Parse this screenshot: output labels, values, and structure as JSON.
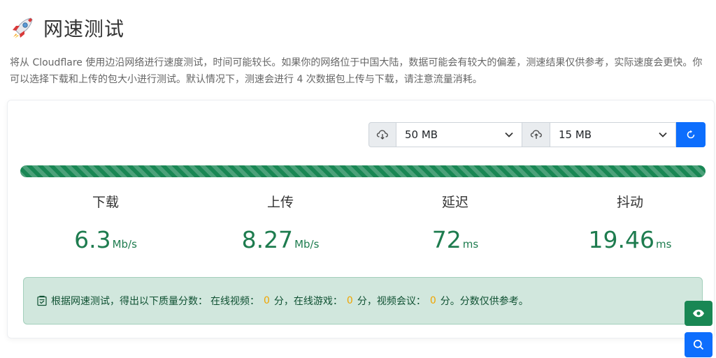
{
  "header": {
    "title": "网速测试",
    "description": "将从 Cloudflare 使用边沿网络进行速度测试，时间可能较长。如果你的网络位于中国大陆，数据可能会有较大的偏差，测速结果仅供参考，实际速度会更快。你可以选择下载和上传的包大小进行测试。默认情况下，测速会进行 4 次数据包上传与下载，请注意流量消耗。"
  },
  "selectors": {
    "download_size": "50 MB",
    "upload_size": "15 MB"
  },
  "progress": {
    "percent": 100
  },
  "metrics": [
    {
      "label": "下载",
      "value": "6.3",
      "unit": "Mb/s"
    },
    {
      "label": "上传",
      "value": "8.27",
      "unit": "Mb/s"
    },
    {
      "label": "延迟",
      "value": "72",
      "unit": "ms"
    },
    {
      "label": "抖动",
      "value": "19.46",
      "unit": "ms"
    }
  ],
  "quality": {
    "prefix": "根据网速测试，得出以下质量分数：",
    "video_label": "在线视频：",
    "video_score": "0",
    "video_suffix": "分，在线游戏：",
    "game_score": "0",
    "game_suffix": "分，视频会议：",
    "meeting_score": "0",
    "meeting_suffix": "分。分数仅供参考。"
  },
  "colors": {
    "accent_green": "#198754",
    "accent_blue": "#0d6efd",
    "score_orange": "#f0a500"
  }
}
